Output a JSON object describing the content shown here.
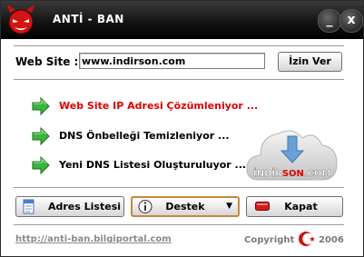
{
  "titlebar": {
    "title": "ANTİ - BAN",
    "minimize_label": "_",
    "close_label": "x"
  },
  "website": {
    "label": "Web Site :",
    "value": "www.indirson.com",
    "allow_button": "İzin Ver"
  },
  "steps": [
    {
      "label": "Web Site IP Adresi Çözümleniyor ...",
      "color": "#e00000"
    },
    {
      "label": "DNS Önbelleği Temizleniyor ...",
      "color": "#000000"
    },
    {
      "label": "Yeni DNS Listesi Oluşturuluyor ...",
      "color": "#000000"
    }
  ],
  "cloud": {
    "brand_prefix": "İNDİR",
    "brand_highlight": "SON",
    "brand_suffix": ".COM"
  },
  "buttons": {
    "address_list": "Adres Listesi",
    "support": "Destek",
    "close": "Kapat"
  },
  "footer": {
    "link": "http://anti-ban.bilgiportal.com",
    "copyright": "Copyright",
    "year": "2006"
  },
  "colors": {
    "accent_red": "#e00000",
    "arrow_green": "#3cb43c",
    "support_border": "#c8883a"
  }
}
